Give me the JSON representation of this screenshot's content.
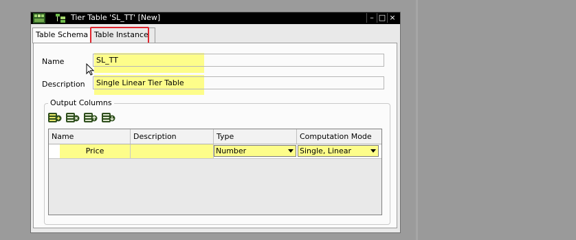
{
  "window": {
    "title": "Tier Table 'SL_TT' [New]",
    "controls": [
      "–",
      "□",
      "×"
    ]
  },
  "tabs": [
    {
      "label": "Table Schema",
      "active": true
    },
    {
      "label": "Table Instance",
      "active": false
    }
  ],
  "form": {
    "name_label": "Name",
    "name_value": "SL_TT",
    "description_label": "Description",
    "description_value": "Single Linear Tier Table"
  },
  "output_columns": {
    "title": "Output Columns",
    "toolbar_icons": [
      "add-column-icon",
      "delete-column-icon",
      "move-up-icon",
      "move-down-icon"
    ],
    "headers": [
      "Name",
      "Description",
      "Type",
      "Computation Mode"
    ],
    "rows": [
      {
        "name": "Price",
        "description": "",
        "type": "Number",
        "computation_mode": "Single, Linear"
      }
    ]
  },
  "colors": {
    "highlight": "#fdfd8a",
    "tab_outline": "#e0242d",
    "background": "#9b9b9b"
  }
}
